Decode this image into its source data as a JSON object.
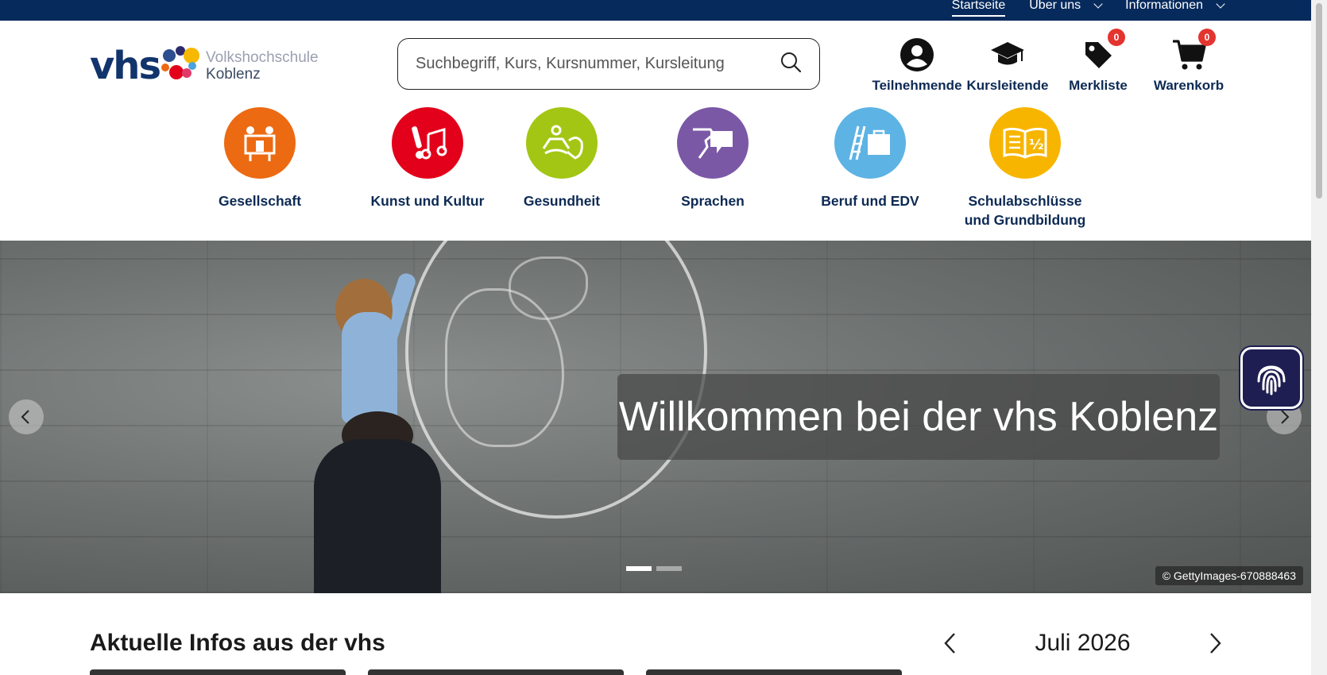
{
  "topnav": {
    "items": [
      {
        "label": "Startseite",
        "active": true
      },
      {
        "label": "Über uns"
      },
      {
        "label": "Informationen"
      }
    ]
  },
  "logo": {
    "mark": "vhs",
    "line1": "Volkshochschule",
    "line2": "Koblenz"
  },
  "search": {
    "placeholder": "Suchbegriff, Kurs, Kursnummer, Kursleitung"
  },
  "tools": {
    "participants": {
      "label": "Teilnehmende",
      "icon": "user-circle-icon"
    },
    "instructors": {
      "label": "Kursleitende",
      "icon": "graduation-cap-icon"
    },
    "wishlist": {
      "label": "Merkliste",
      "icon": "tag-icon",
      "count": "0"
    },
    "cart": {
      "label": "Warenkorb",
      "icon": "cart-icon",
      "count": "0"
    }
  },
  "categories": [
    {
      "name": "Gesellschaft",
      "color": "#ec6a12",
      "icon": "people-board-icon"
    },
    {
      "name": "Kunst und Kultur",
      "color": "#e2001a",
      "icon": "brush-music-icon"
    },
    {
      "name": "Gesundheit",
      "color": "#a3c614",
      "icon": "yoga-apple-icon"
    },
    {
      "name": "Sprachen",
      "color": "#7b58a6",
      "icon": "speech-bubble-icon"
    },
    {
      "name": "Beruf und EDV",
      "color": "#5db3e4",
      "icon": "ladder-briefcase-icon"
    },
    {
      "name": "Schulabschlüsse und Grundbildung",
      "color": "#f7b500",
      "icon": "book-half-icon"
    }
  ],
  "hero": {
    "title": "Willkommen bei der vhs Koblenz",
    "credit": "© GettyImages-670888463",
    "slides": 2,
    "active_slide": 1
  },
  "news": {
    "title": "Aktuelle Infos aus der vhs"
  },
  "calendar": {
    "month": "Juli 2026"
  },
  "colors": {
    "navy": "#062a5c",
    "text": "#0d2a54",
    "badge": "#e3342f",
    "a11y": "#1e1e52"
  }
}
